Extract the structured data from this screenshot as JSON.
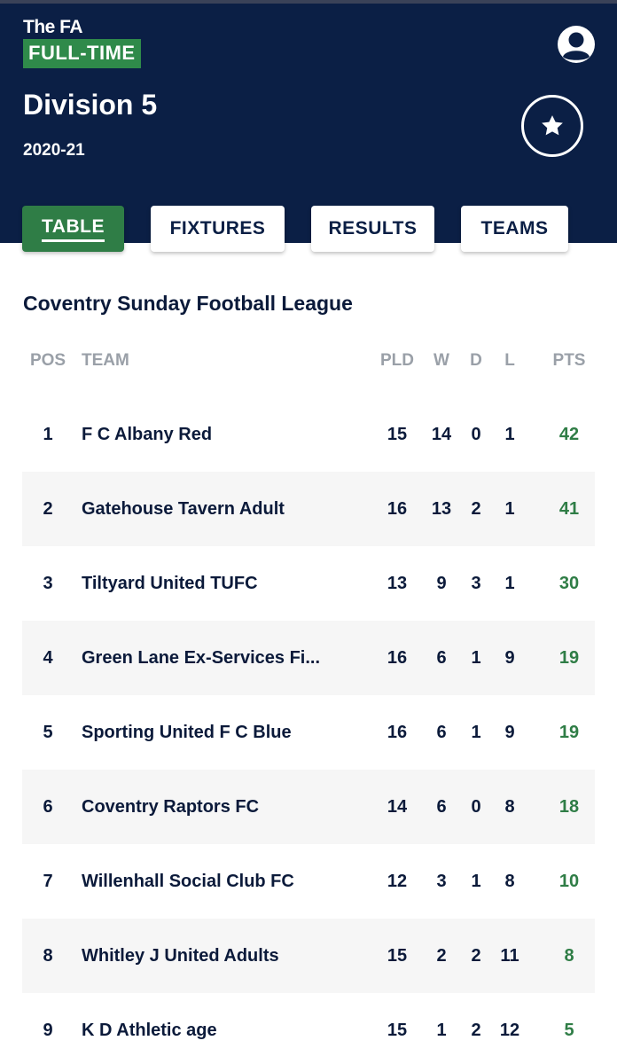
{
  "header": {
    "logo_top": "The FA",
    "logo_badge": "FULL-TIME",
    "title": "Division 5",
    "season": "2020-21"
  },
  "tabs": [
    {
      "label": "TABLE",
      "active": true
    },
    {
      "label": "FIXTURES",
      "active": false
    },
    {
      "label": "RESULTS",
      "active": false
    },
    {
      "label": "TEAMS",
      "active": false
    }
  ],
  "league_name": "Coventry Sunday Football League",
  "table": {
    "columns": {
      "pos": "POS",
      "team": "TEAM",
      "pld": "PLD",
      "w": "W",
      "d": "D",
      "l": "L",
      "pts": "PTS"
    },
    "rows": [
      {
        "pos": "1",
        "team": "F C Albany Red",
        "pld": "15",
        "w": "14",
        "d": "0",
        "l": "1",
        "pts": "42"
      },
      {
        "pos": "2",
        "team": "Gatehouse Tavern Adult",
        "pld": "16",
        "w": "13",
        "d": "2",
        "l": "1",
        "pts": "41"
      },
      {
        "pos": "3",
        "team": "Tiltyard United TUFC",
        "pld": "13",
        "w": "9",
        "d": "3",
        "l": "1",
        "pts": "30"
      },
      {
        "pos": "4",
        "team": "Green Lane Ex-Services Fi...",
        "pld": "16",
        "w": "6",
        "d": "1",
        "l": "9",
        "pts": "19"
      },
      {
        "pos": "5",
        "team": "Sporting United F C Blue",
        "pld": "16",
        "w": "6",
        "d": "1",
        "l": "9",
        "pts": "19"
      },
      {
        "pos": "6",
        "team": "Coventry Raptors FC",
        "pld": "14",
        "w": "6",
        "d": "0",
        "l": "8",
        "pts": "18"
      },
      {
        "pos": "7",
        "team": "Willenhall Social Club FC",
        "pld": "12",
        "w": "3",
        "d": "1",
        "l": "8",
        "pts": "10"
      },
      {
        "pos": "8",
        "team": "Whitley J United Adults",
        "pld": "15",
        "w": "2",
        "d": "2",
        "l": "11",
        "pts": "8"
      },
      {
        "pos": "9",
        "team": "K D Athletic age",
        "pld": "15",
        "w": "1",
        "d": "2",
        "l": "12",
        "pts": "5"
      }
    ]
  },
  "icons": {
    "user": "user-icon",
    "star": "star-icon"
  },
  "colors": {
    "header_bg": "#0b1f45",
    "accent_green": "#2f7d46",
    "text_dark": "#0b1a3a",
    "header_gray": "#9aa0a8"
  }
}
